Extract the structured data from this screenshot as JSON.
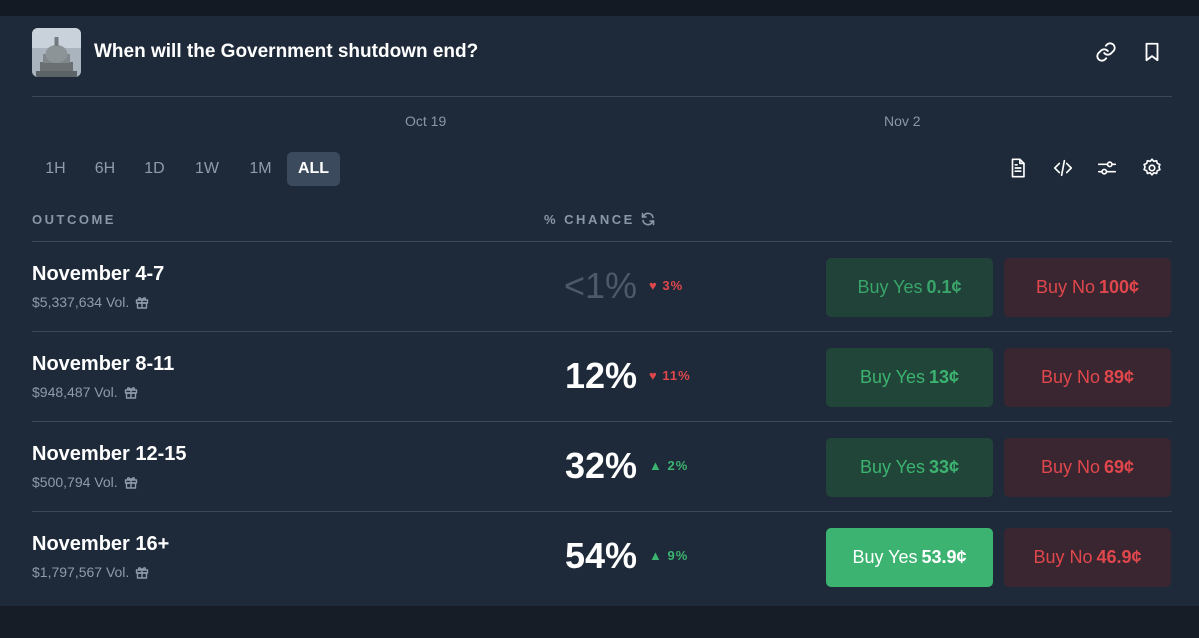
{
  "market": {
    "title": "When will the Government shutdown end?"
  },
  "chart": {
    "x_ticks": [
      "Oct 19",
      "Nov 2"
    ]
  },
  "ranges": [
    "1H",
    "6H",
    "1D",
    "1W",
    "1M",
    "ALL"
  ],
  "active_range": "ALL",
  "table": {
    "outcome_header": "OUTCOME",
    "chance_header": "% CHANCE"
  },
  "outcomes": [
    {
      "name": "November 4-7",
      "volume": "$5,337,634 Vol.",
      "chance": "<1%",
      "delta": "3%",
      "delta_dir": "down",
      "buy_yes_label": "Buy Yes",
      "buy_yes_price": "0.1¢",
      "buy_no_label": "Buy No",
      "buy_no_price": "100¢"
    },
    {
      "name": "November 8-11",
      "volume": "$948,487 Vol.",
      "chance": "12%",
      "delta": "11%",
      "delta_dir": "down",
      "buy_yes_label": "Buy Yes",
      "buy_yes_price": "13¢",
      "buy_no_label": "Buy No",
      "buy_no_price": "89¢"
    },
    {
      "name": "November 12-15",
      "volume": "$500,794 Vol.",
      "chance": "32%",
      "delta": "2%",
      "delta_dir": "up",
      "buy_yes_label": "Buy Yes",
      "buy_yes_price": "33¢",
      "buy_no_label": "Buy No",
      "buy_no_price": "69¢"
    },
    {
      "name": "November 16+",
      "volume": "$1,797,567 Vol.",
      "chance": "54%",
      "delta": "9%",
      "delta_dir": "up",
      "buy_yes_label": "Buy Yes",
      "buy_yes_price": "53.9¢",
      "buy_no_label": "Buy No",
      "buy_no_price": "46.9¢"
    }
  ],
  "icons": {
    "header": [
      "link-icon",
      "bookmark-icon"
    ],
    "toolbar": [
      "document-icon",
      "embed-code-icon",
      "sliders-icon",
      "settings-gear-icon"
    ],
    "refresh": "refresh-icon",
    "gift": "gift-icon"
  },
  "colors": {
    "background": "#1e2a39",
    "yes_green": "#3cb370",
    "no_red": "#e0474c",
    "active_range_bg": "#3b4a5d"
  }
}
